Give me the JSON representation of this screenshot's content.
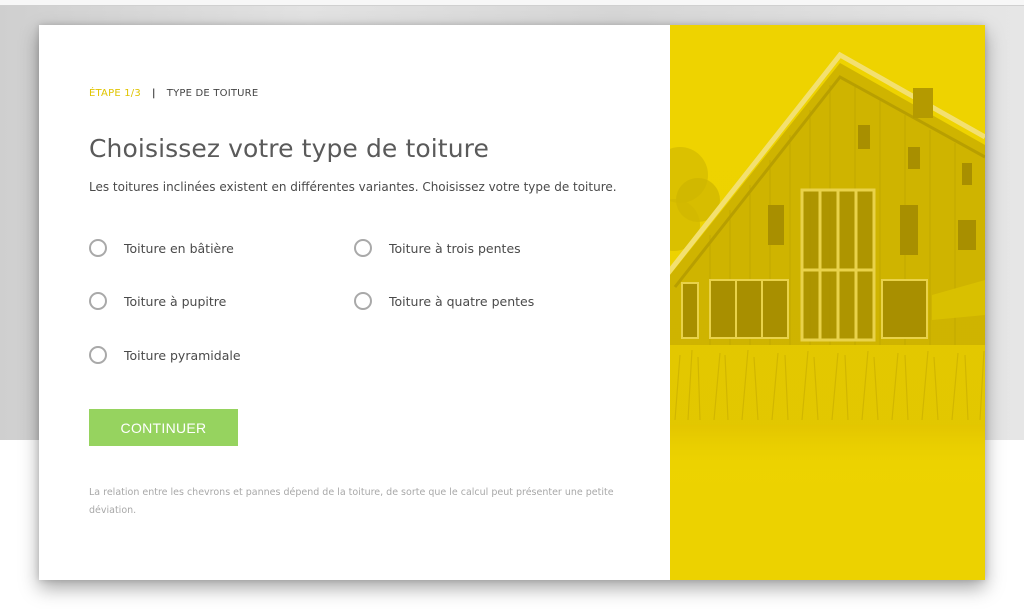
{
  "step": {
    "number": "ÉTAPE 1/3",
    "separator": "|",
    "name": "TYPE DE TOITURE"
  },
  "title": "Choisissez votre type de toiture",
  "subtitle": "Les toitures inclinées existent en différentes variantes. Choisissez votre type de toiture.",
  "options": [
    {
      "label": "Toiture en bâtière",
      "selected": false
    },
    {
      "label": "Toiture à trois pentes",
      "selected": false
    },
    {
      "label": "Toiture à pupitre",
      "selected": false
    },
    {
      "label": "Toiture à quatre pentes",
      "selected": false
    },
    {
      "label": "Toiture pyramidale",
      "selected": false
    }
  ],
  "continue_label": "CONTINUER",
  "note": "La relation entre les chevrons et pannes dépend de la toiture, de sorte que le calcul peut présenter une petite déviation.",
  "colors": {
    "accent_yellow": "#ecd400",
    "button_green": "#96d35f",
    "step_number": "#e0c400"
  },
  "image": {
    "icon": "house-photo"
  }
}
